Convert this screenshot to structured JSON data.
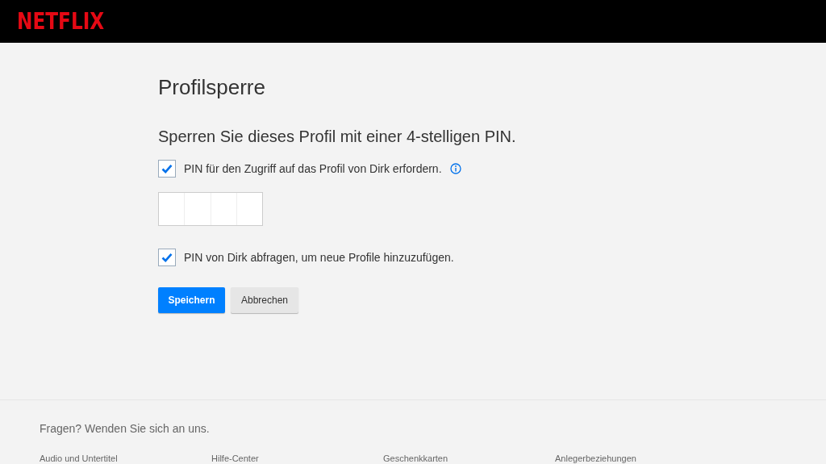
{
  "header": {
    "logo": "NETFLIX"
  },
  "title": "Profilsperre",
  "subtitle": "Sperren Sie dieses Profil mit einer 4-stelligen PIN.",
  "options": [
    {
      "label": "PIN für den Zugriff auf das Profil von Dirk erfordern.",
      "checked": true,
      "info": true,
      "pin_field": true
    },
    {
      "label": "PIN von Dirk abfragen, um neue Profile hinzuzufügen.",
      "checked": true,
      "info": false
    }
  ],
  "buttons": [
    {
      "label": "Speichern",
      "kind": "primary"
    },
    {
      "label": "Abbrechen",
      "kind": "secondary"
    }
  ],
  "footer": {
    "question": "Fragen? Wenden Sie sich an uns.",
    "links": [
      "Audio und Untertitel",
      "Hilfe-Center",
      "Geschenkkarten",
      "Anlegerbeziehungen"
    ]
  }
}
